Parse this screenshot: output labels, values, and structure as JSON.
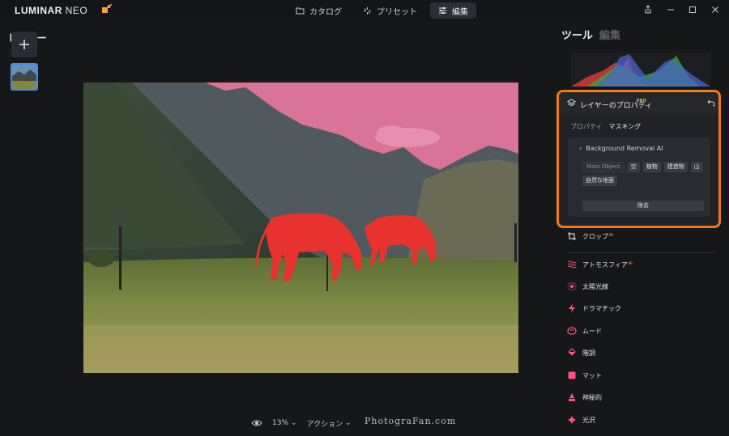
{
  "app": {
    "logo_main": "LUMINAR",
    "logo_neo": "NEO"
  },
  "modes": [
    {
      "label": "カタログ",
      "icon": "folder-icon"
    },
    {
      "label": "プリセット",
      "icon": "sparkle-icon"
    },
    {
      "label": "編集",
      "icon": "sliders-icon",
      "active": true
    }
  ],
  "left_panel": {
    "title": "レイヤー"
  },
  "right_panel": {
    "tab_tools": "ツール",
    "tab_edit": "編集"
  },
  "layer_properties": {
    "title": "レイヤーのプロパティ",
    "pro_badge": "PRO",
    "tabs": [
      {
        "label": "プロパティ",
        "active": false
      },
      {
        "label": "マスキング",
        "active": true
      }
    ],
    "bg_removal": {
      "title": "Background Removal AI",
      "chips": [
        "Main Object",
        "空",
        "植物",
        "建造物",
        "山",
        "自然な地面"
      ],
      "remove_label": "除去"
    }
  },
  "tools": [
    {
      "label": "クロップ",
      "ai": "AI",
      "icon": "crop-icon",
      "color": "#cfcfcf"
    },
    {
      "label": "アトモスフィア",
      "ai": "AI",
      "icon": "atmosphere-icon",
      "color": "#ff4f8b"
    },
    {
      "label": "太陽光線",
      "ai": "",
      "icon": "sun-rays-icon",
      "color": "#ff4f8b"
    },
    {
      "label": "ドラマチック",
      "ai": "",
      "icon": "lightning-icon",
      "color": "#ff4f8b"
    },
    {
      "label": "ムード",
      "ai": "",
      "icon": "mood-icon",
      "color": "#ff4f8b"
    },
    {
      "label": "階調",
      "ai": "",
      "icon": "paint-bucket-icon",
      "color": "#ff4f8b"
    },
    {
      "label": "マット",
      "ai": "",
      "icon": "matte-square-icon",
      "color": "#ff4f8b"
    },
    {
      "label": "神秘的",
      "ai": "",
      "icon": "mystical-icon",
      "color": "#ff4f8b"
    },
    {
      "label": "光沢",
      "ai": "",
      "icon": "glow-sparkle-icon",
      "color": "#ff4f8b"
    }
  ],
  "bottom_bar": {
    "zoom": "13%",
    "actions_label": "アクション"
  },
  "watermark": "PhotograFan.com",
  "colors": {
    "accent_orange": "#f07b14",
    "tool_pink": "#ff4f8b",
    "mask_red": "#e8322e",
    "sky_pink": "#d9739a"
  }
}
